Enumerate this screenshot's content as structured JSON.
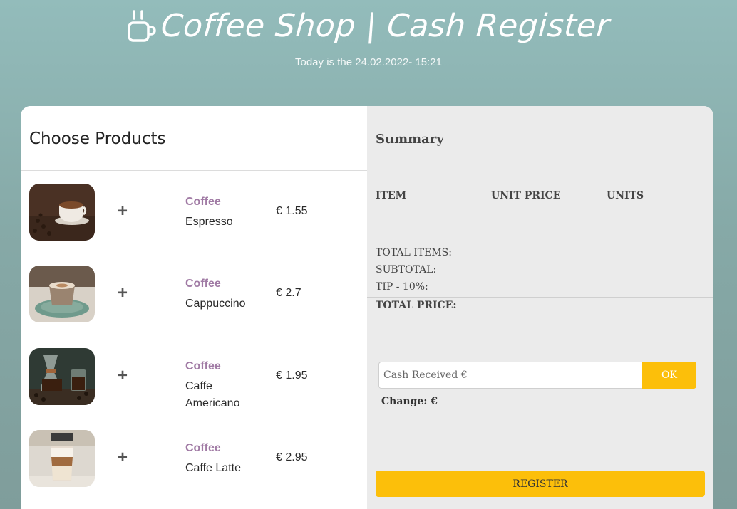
{
  "header": {
    "title": "Coffee Shop | Cash Register",
    "date_line": "Today is the 24.02.2022- 15:21"
  },
  "products_panel": {
    "heading": "Choose Products",
    "items": [
      {
        "category": "Coffee",
        "name": "Espresso",
        "price": "€ 1.55",
        "add_icon": "+"
      },
      {
        "category": "Coffee",
        "name": "Cappuccino",
        "price": "€ 2.7",
        "add_icon": "+"
      },
      {
        "category": "Coffee",
        "name": "Caffe Americano",
        "price": "€ 1.95",
        "add_icon": "+"
      },
      {
        "category": "Coffee",
        "name": "Caffe Latte",
        "price": "€ 2.95",
        "add_icon": "+"
      }
    ]
  },
  "summary": {
    "heading": "Summary",
    "columns": [
      "ITEM",
      "UNIT PRICE",
      "UNITS"
    ],
    "total_items_label": "TOTAL ITEMS:",
    "subtotal_label": "SUBTOTAL:",
    "tip_label": "TIP - 10%:",
    "total_price_label": "TOTAL PRICE:",
    "cash_placeholder": "Cash Received €",
    "ok_label": "OK",
    "change_label": "Change: €",
    "register_label": "REGISTER"
  },
  "colors": {
    "accent_yellow": "#fcbf0a",
    "category_purple": "#a07aa4",
    "summary_bg": "#ebebeb"
  },
  "icons": {
    "title_icon": "coffee-cup-icon",
    "add_icon": "plus-icon"
  }
}
